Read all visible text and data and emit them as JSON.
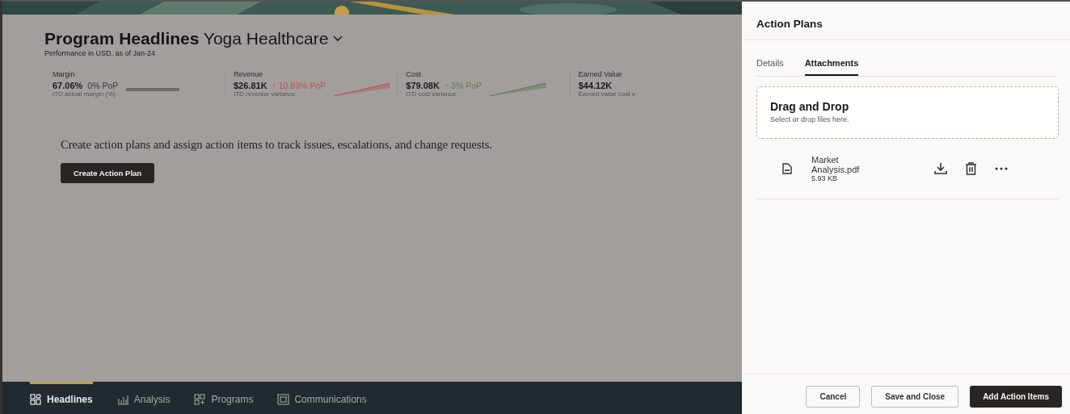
{
  "page": {
    "title": "Program Headlines",
    "program": "Yoga Healthcare",
    "subtitle": "Performance in USD, as of Jan-24",
    "metrics": [
      {
        "label": "Margin",
        "value": "67.06%",
        "change": "0% PoP",
        "kind": "flat",
        "color": "#3e3a38",
        "caption": "ITD actual margin (%)"
      },
      {
        "label": "Revenue",
        "value": "$26.81K",
        "change": "↑ 10.89% PoP",
        "kind": "rising",
        "color": "#b5565a",
        "caption": "ITD revenue variance"
      },
      {
        "label": "Cost",
        "value": "$79.08K",
        "change": "↑ 3% PoP",
        "kind": "rising",
        "color": "#5f7d57",
        "caption": "ITD cost variance"
      },
      {
        "label": "Earned Value",
        "value": "$44.12K",
        "caption": "Earned value cost v"
      }
    ],
    "message": "Create action plans and assign action items to track issues, escalations, and change requests.",
    "create_button": "Create Action Plan"
  },
  "nav": [
    {
      "label": "Headlines",
      "selected": true
    },
    {
      "label": "Analysis",
      "selected": false
    },
    {
      "label": "Programs",
      "selected": false
    },
    {
      "label": "Communications",
      "selected": false
    }
  ],
  "panel": {
    "title": "Action Plans",
    "tabs": [
      {
        "label": "Details",
        "selected": false
      },
      {
        "label": "Attachments",
        "selected": true
      }
    ],
    "dropzone": {
      "title": "Drag and Drop",
      "hint": "Select or drop files here."
    },
    "files": [
      {
        "name": "Market Analysis.pdf",
        "size": "5.93 KB"
      }
    ],
    "buttons": [
      {
        "label": "Cancel",
        "kind": "secondary"
      },
      {
        "label": "Save and Close",
        "kind": "secondary"
      },
      {
        "label": "Add Action Items",
        "kind": "primary"
      }
    ]
  }
}
